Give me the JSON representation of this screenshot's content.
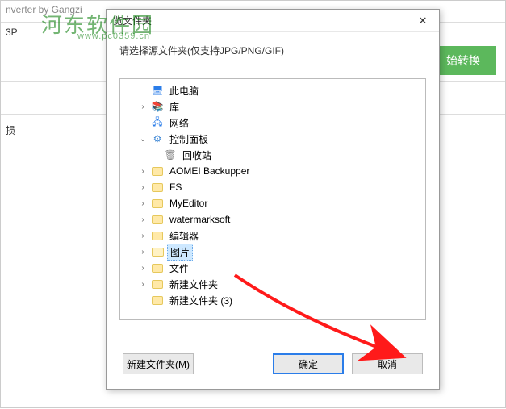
{
  "background": {
    "title_fragment": "nverter by Gangzi",
    "row1_fragment": "3P",
    "row2_fragment": "损"
  },
  "watermark": {
    "main": "河东软件园",
    "sub": "www.pc0359.cn"
  },
  "convert_button": "始转换",
  "dialog": {
    "title": "览文件夹",
    "instruction": "请选择源文件夹(仅支持JPG/PNG/GIF)",
    "buttons": {
      "new_folder": "新建文件夹(M)",
      "ok": "确定",
      "cancel": "取消"
    }
  },
  "tree": {
    "items": [
      {
        "label": "此电脑",
        "icon": "pc",
        "depth": 1,
        "expander": ""
      },
      {
        "label": "库",
        "icon": "lib",
        "depth": 1,
        "expander": "›"
      },
      {
        "label": "网络",
        "icon": "net",
        "depth": 1,
        "expander": ""
      },
      {
        "label": "控制面板",
        "icon": "cp",
        "depth": 1,
        "expander": "⌄"
      },
      {
        "label": "回收站",
        "icon": "bin",
        "depth": 2,
        "expander": ""
      },
      {
        "label": "AOMEI Backupper",
        "icon": "folder",
        "depth": 1,
        "expander": "›"
      },
      {
        "label": "FS",
        "icon": "folder",
        "depth": 1,
        "expander": "›"
      },
      {
        "label": "MyEditor",
        "icon": "folder",
        "depth": 1,
        "expander": "›"
      },
      {
        "label": "watermarksoft",
        "icon": "folder",
        "depth": 1,
        "expander": "›"
      },
      {
        "label": "编辑器",
        "icon": "folder",
        "depth": 1,
        "expander": "›"
      },
      {
        "label": "图片",
        "icon": "folder-open",
        "depth": 1,
        "expander": "›",
        "selected": true
      },
      {
        "label": "文件",
        "icon": "folder",
        "depth": 1,
        "expander": "›"
      },
      {
        "label": "新建文件夹",
        "icon": "folder",
        "depth": 1,
        "expander": "›"
      },
      {
        "label": "新建文件夹 (3)",
        "icon": "folder",
        "depth": 1,
        "expander": ""
      }
    ]
  }
}
